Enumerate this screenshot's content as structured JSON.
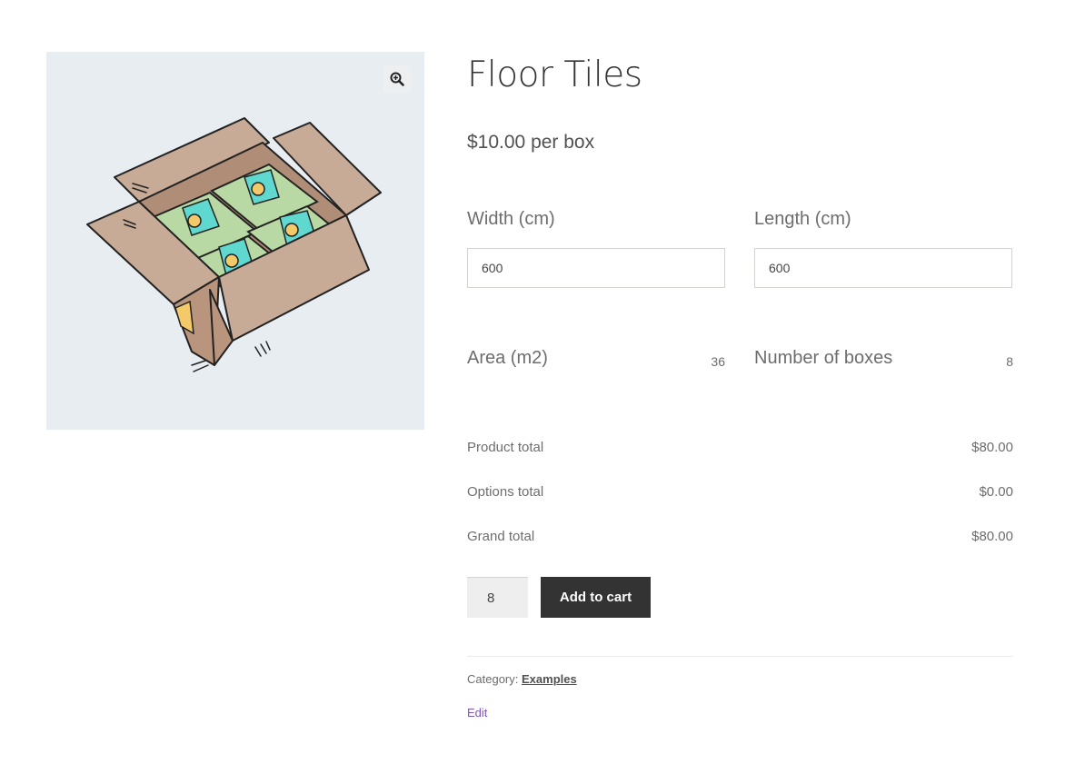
{
  "product": {
    "title": "Floor Tiles",
    "price": "$10.00 per box",
    "image_alt": "Open cardboard box containing four green tiles"
  },
  "gallery": {
    "zoom_icon": "magnifier-plus-icon",
    "background_color": "#e8edf2"
  },
  "fields": {
    "width": {
      "label": "Width (cm)",
      "value": "600"
    },
    "length": {
      "label": "Length (cm)",
      "value": "600"
    }
  },
  "calculated": {
    "area": {
      "label": "Area (m2)",
      "value": "36"
    },
    "boxes": {
      "label": "Number of boxes",
      "value": "8"
    }
  },
  "totals": [
    {
      "label": "Product total",
      "value": "$80.00"
    },
    {
      "label": "Options total",
      "value": "$0.00"
    },
    {
      "label": "Grand total",
      "value": "$80.00"
    }
  ],
  "cart": {
    "quantity": "8",
    "add_label": "Add to cart",
    "button_color": "#333333"
  },
  "meta": {
    "category_label": "Category:",
    "category_value": "Examples",
    "edit_label": "Edit",
    "edit_color": "#7f54b3"
  }
}
